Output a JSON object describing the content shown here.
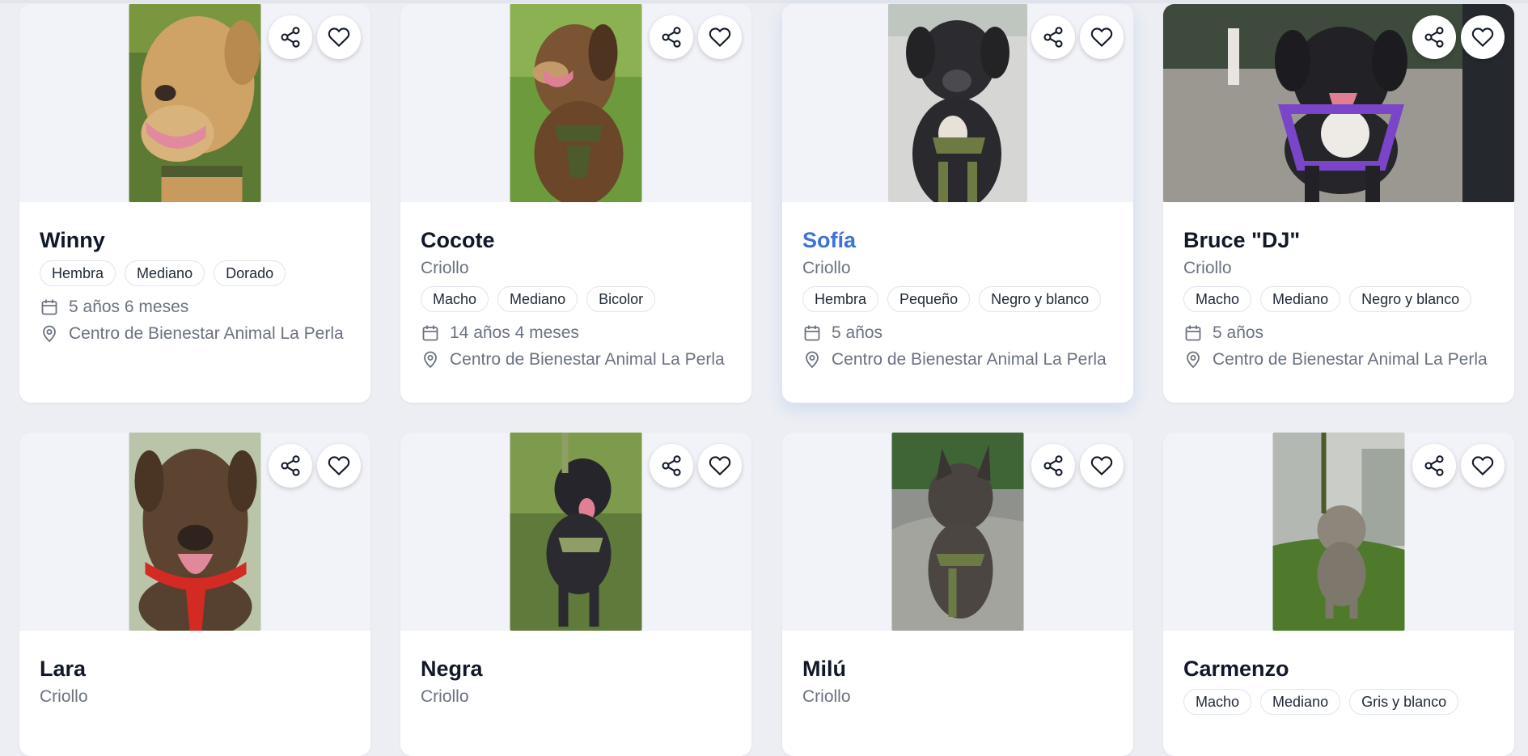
{
  "pets": [
    {
      "name": "Winny",
      "breed": "",
      "tags": [
        "Hembra",
        "Mediano",
        "Dorado"
      ],
      "age": "5 años 6 meses",
      "location": "Centro de Bienestar Animal La Perla"
    },
    {
      "name": "Cocote",
      "breed": "Criollo",
      "tags": [
        "Macho",
        "Mediano",
        "Bicolor"
      ],
      "age": "14 años 4 meses",
      "location": "Centro de Bienestar Animal La Perla"
    },
    {
      "name": "Sofía",
      "breed": "Criollo",
      "tags": [
        "Hembra",
        "Pequeño",
        "Negro y blanco"
      ],
      "age": "5 años",
      "location": "Centro de Bienestar Animal La Perla"
    },
    {
      "name": "Bruce \"DJ\"",
      "breed": "Criollo",
      "tags": [
        "Macho",
        "Mediano",
        "Negro y blanco"
      ],
      "age": "5 años",
      "location": "Centro de Bienestar Animal La Perla"
    },
    {
      "name": "Lara",
      "breed": "Criollo"
    },
    {
      "name": "Negra",
      "breed": "Criollo"
    },
    {
      "name": "Milú",
      "breed": "Criollo"
    },
    {
      "name": "Carmenzo",
      "breed": "",
      "tags": [
        "Macho",
        "Mediano",
        "Gris y blanco"
      ]
    }
  ],
  "icons": {
    "share": "share-icon",
    "favorite": "heart-icon",
    "age": "calendar-icon",
    "location": "map-pin-icon"
  },
  "colors": {
    "link": "#3b74d6",
    "page_bg": "#eceef3",
    "media_bg": "#f1f3f8"
  }
}
